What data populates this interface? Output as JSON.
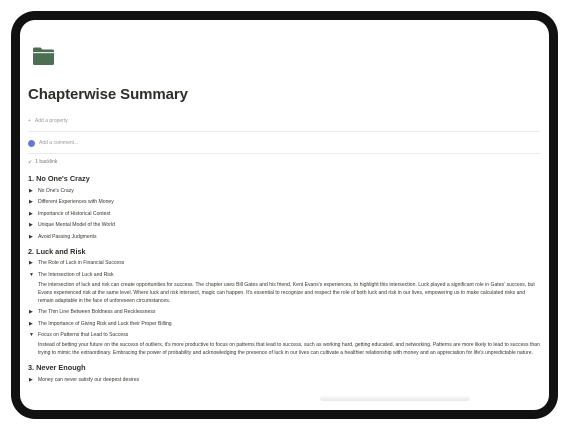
{
  "page": {
    "icon": "folder-icon",
    "title": "Chapterwise Summary",
    "add_property": "Add a property",
    "add_comment_placeholder": "Add a comment...",
    "backlinks": "1 backlink"
  },
  "colors": {
    "folder_icon": "#4c6e53",
    "avatar": "#6c78c7"
  },
  "sections": [
    {
      "heading": "1. No One's Crazy",
      "items": [
        {
          "label": "No One's Crazy",
          "expanded": false
        },
        {
          "label": "Different Experiences with Money",
          "expanded": false
        },
        {
          "label": "Importance of Historical Context",
          "expanded": false
        },
        {
          "label": "Unique Mental Model of the World",
          "expanded": false
        },
        {
          "label": "Avoid Passing Judgments",
          "expanded": false
        }
      ]
    },
    {
      "heading": "2. Luck and Risk",
      "items": [
        {
          "label": "The Role of Luck in Financial Success",
          "expanded": false
        },
        {
          "label": "The Intersection of Luck and Risk",
          "expanded": true,
          "body": "The intersection of luck and risk can create opportunities for success. The chapter uses Bill Gates and his friend, Kent Evans's experiences, to highlight this intersection. Luck played a significant role in Gates' success, but Evans experienced risk at the same level. Where luck and risk intersect, magic can happen. It's essential to recognize and respect the role of both luck and risk in our lives, empowering us to make calculated risks and remain adaptable in the face of unforeseen circumstances."
        },
        {
          "label": "The Thin Line Between Boldness and Recklessness",
          "expanded": false
        },
        {
          "label": "The Importance of Giving Risk and Luck their Proper Billing",
          "expanded": false
        },
        {
          "label": "Focus on Patterns that Lead to Success",
          "expanded": true,
          "body": "Instead of betting your future on the success of outliers, it's more productive to focus on patterns that lead to success, such as working hard, getting educated, and networking. Patterns are more likely to lead to success than trying to mimic the extraordinary. Embracing the power of probability and acknowledging the presence of luck in our lives can cultivate a healthier relationship with money and an appreciation for life's unpredictable nature."
        }
      ]
    },
    {
      "heading": "3. Never Enough",
      "items": [
        {
          "label": "Money can never satisfy our deepest desires",
          "expanded": false
        }
      ]
    }
  ]
}
